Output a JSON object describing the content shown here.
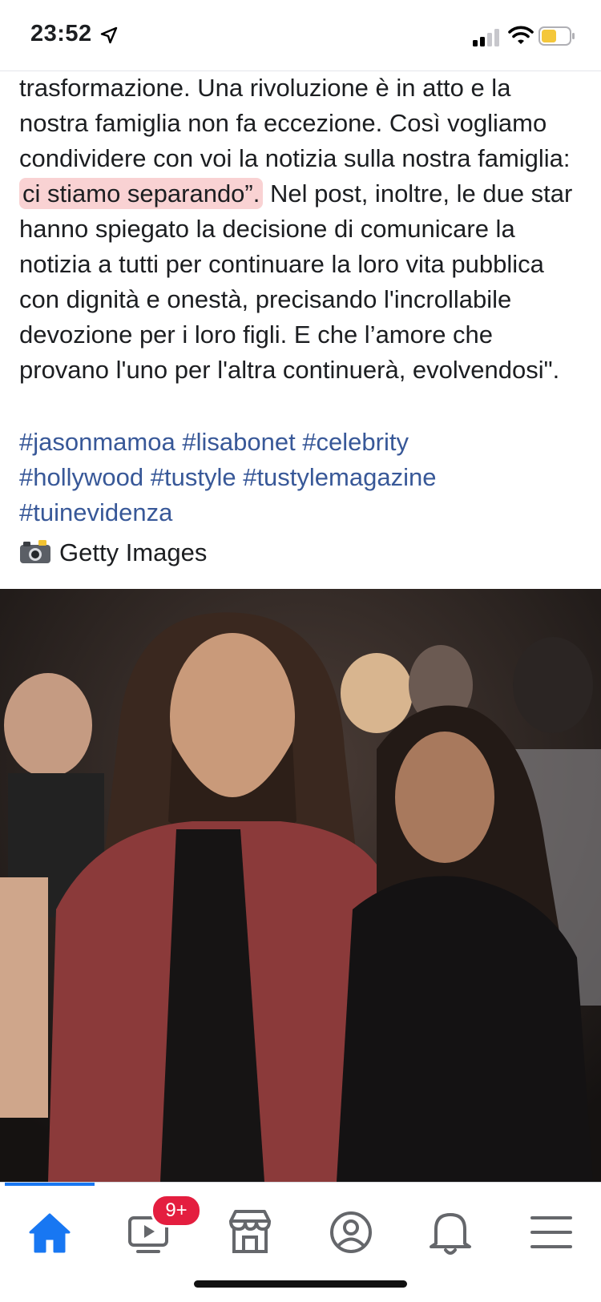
{
  "status_bar": {
    "time": "23:52"
  },
  "post": {
    "text_before": "trasformazione. Una rivoluzione è in atto e la nostra famiglia non fa eccezione. Così vogliamo condividere con voi la notizia sulla nostra famiglia: ",
    "highlighted": "ci stiamo separando”.",
    "text_after": " Nel post, inoltre, le due star hanno spiegato la decisione di comunicare la notizia a tutti per continuare la loro vita pubblica con dignità e onestà, precisando l'incrollabile devozione per i loro figli. E che l’amore che provano l'uno per l'altra continuerà, evolvendosi\".",
    "hashtags": [
      "#jasonmamoa",
      "#lisabonet",
      "#celebrity",
      "#hollywood",
      "#tustyle",
      "#tustylemagazine",
      "#tuinevidenza"
    ],
    "credit": "Getty Images"
  },
  "tab_bar": {
    "video_badge": "9+",
    "tabs": [
      "home-icon",
      "video-icon",
      "marketplace-icon",
      "profile-icon",
      "notifications-icon",
      "menu-icon"
    ],
    "accent_color": "#1877f2"
  }
}
